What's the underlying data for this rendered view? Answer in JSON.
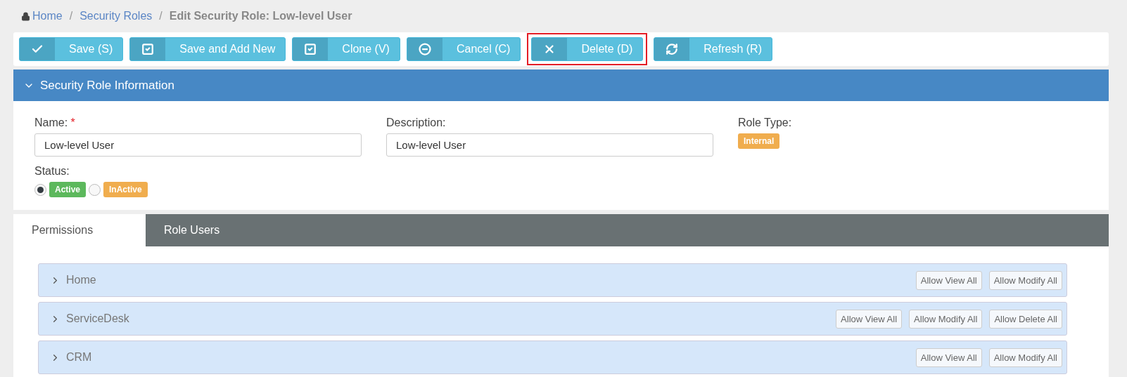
{
  "breadcrumb": {
    "items": [
      {
        "label": "Home",
        "kind": "link"
      },
      {
        "label": "Security Roles",
        "kind": "link"
      },
      {
        "label": "Edit Security Role: Low-level User",
        "kind": "current"
      }
    ],
    "separator": "/"
  },
  "toolbar": {
    "buttons": [
      {
        "label": "Save (S)",
        "highlighted": false
      },
      {
        "label": "Save and Add New",
        "highlighted": false
      },
      {
        "label": "Clone (V)",
        "highlighted": false
      },
      {
        "label": "Cancel (C)",
        "highlighted": false
      },
      {
        "label": "Delete (D)",
        "highlighted": true
      },
      {
        "label": "Refresh (R)",
        "highlighted": false
      }
    ]
  },
  "panel": {
    "title": "Security Role Information",
    "expanded": true,
    "name": {
      "label": "Name:",
      "required_mark": "*",
      "value": "Low-level User"
    },
    "description": {
      "label": "Description:",
      "value": "Low-level User"
    },
    "role_type": {
      "label": "Role Type:",
      "badge": "Internal",
      "color": "#f0ad4e"
    },
    "status": {
      "label": "Status:",
      "options": [
        {
          "label": "Active",
          "selected": true,
          "color": "#5cb85c"
        },
        {
          "label": "InActive",
          "selected": false,
          "color": "#f0ad4e"
        }
      ]
    }
  },
  "tabs": [
    {
      "label": "Permissions",
      "selected": true
    },
    {
      "label": "Role Users",
      "selected": false
    }
  ],
  "permissions": [
    {
      "module": "Home",
      "expanded": false,
      "actions": [
        "Allow View All",
        "Allow Modify All"
      ]
    },
    {
      "module": "ServiceDesk",
      "expanded": false,
      "actions": [
        "Allow View All",
        "Allow Modify All",
        "Allow Delete All"
      ]
    },
    {
      "module": "CRM",
      "expanded": false,
      "actions": [
        "Allow View All",
        "Allow Modify All"
      ]
    }
  ]
}
